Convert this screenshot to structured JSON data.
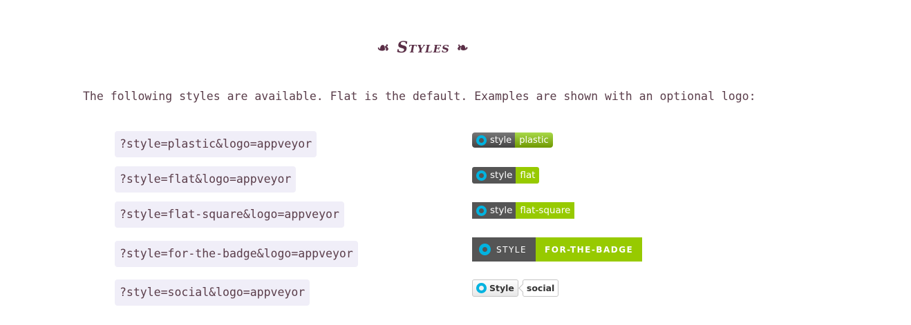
{
  "heading": {
    "ornament_left": "☙",
    "title": "Styles",
    "ornament_right": "❧"
  },
  "intro": "The following styles are available. Flat is the default. Examples are shown with an optional logo:",
  "styles": [
    {
      "query": "?style=plastic&logo=appveyor",
      "label": "style",
      "message": "plastic"
    },
    {
      "query": "?style=flat&logo=appveyor",
      "label": "style",
      "message": "flat"
    },
    {
      "query": "?style=flat-square&logo=appveyor",
      "label": "style",
      "message": "flat-square"
    },
    {
      "query": "?style=for-the-badge&logo=appveyor",
      "label": "STYLE",
      "message": "FOR-THE-BADGE"
    },
    {
      "query": "?style=social&logo=appveyor",
      "label": "Style",
      "message": "social"
    }
  ],
  "logo_icon": "appveyor-icon",
  "colors": {
    "label_bg": "#555555",
    "message_bg": "#97ca00",
    "logo": "#00b3e0"
  }
}
